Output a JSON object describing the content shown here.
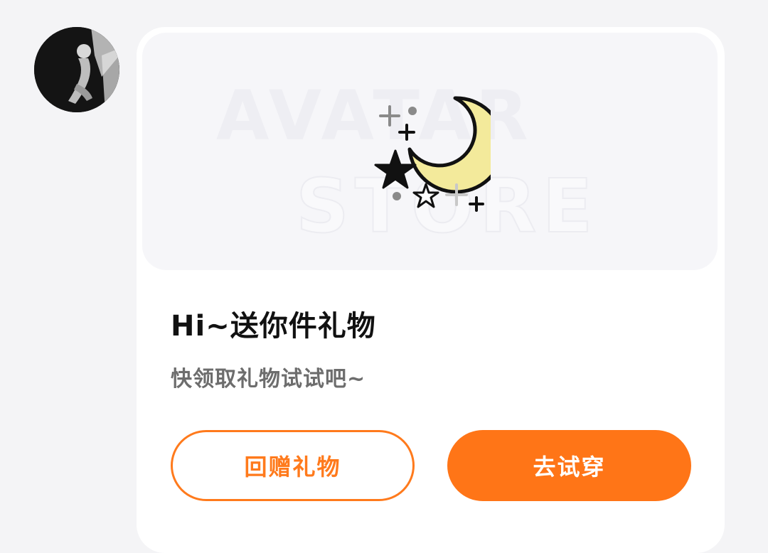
{
  "message": {
    "title": "Hi~送你件礼物",
    "subtitle": "快领取礼物试试吧~",
    "banner": {
      "watermark_line1": "AVATAR",
      "watermark_line2": "STORE",
      "illustration": "moon-and-stars-icon"
    },
    "buttons": {
      "return_gift": "回赠礼物",
      "try_on": "去试穿"
    }
  },
  "colors": {
    "accent": "#ff7517",
    "moon": "#f3ea9b",
    "background": "#f4f4f6",
    "card": "#ffffff"
  }
}
